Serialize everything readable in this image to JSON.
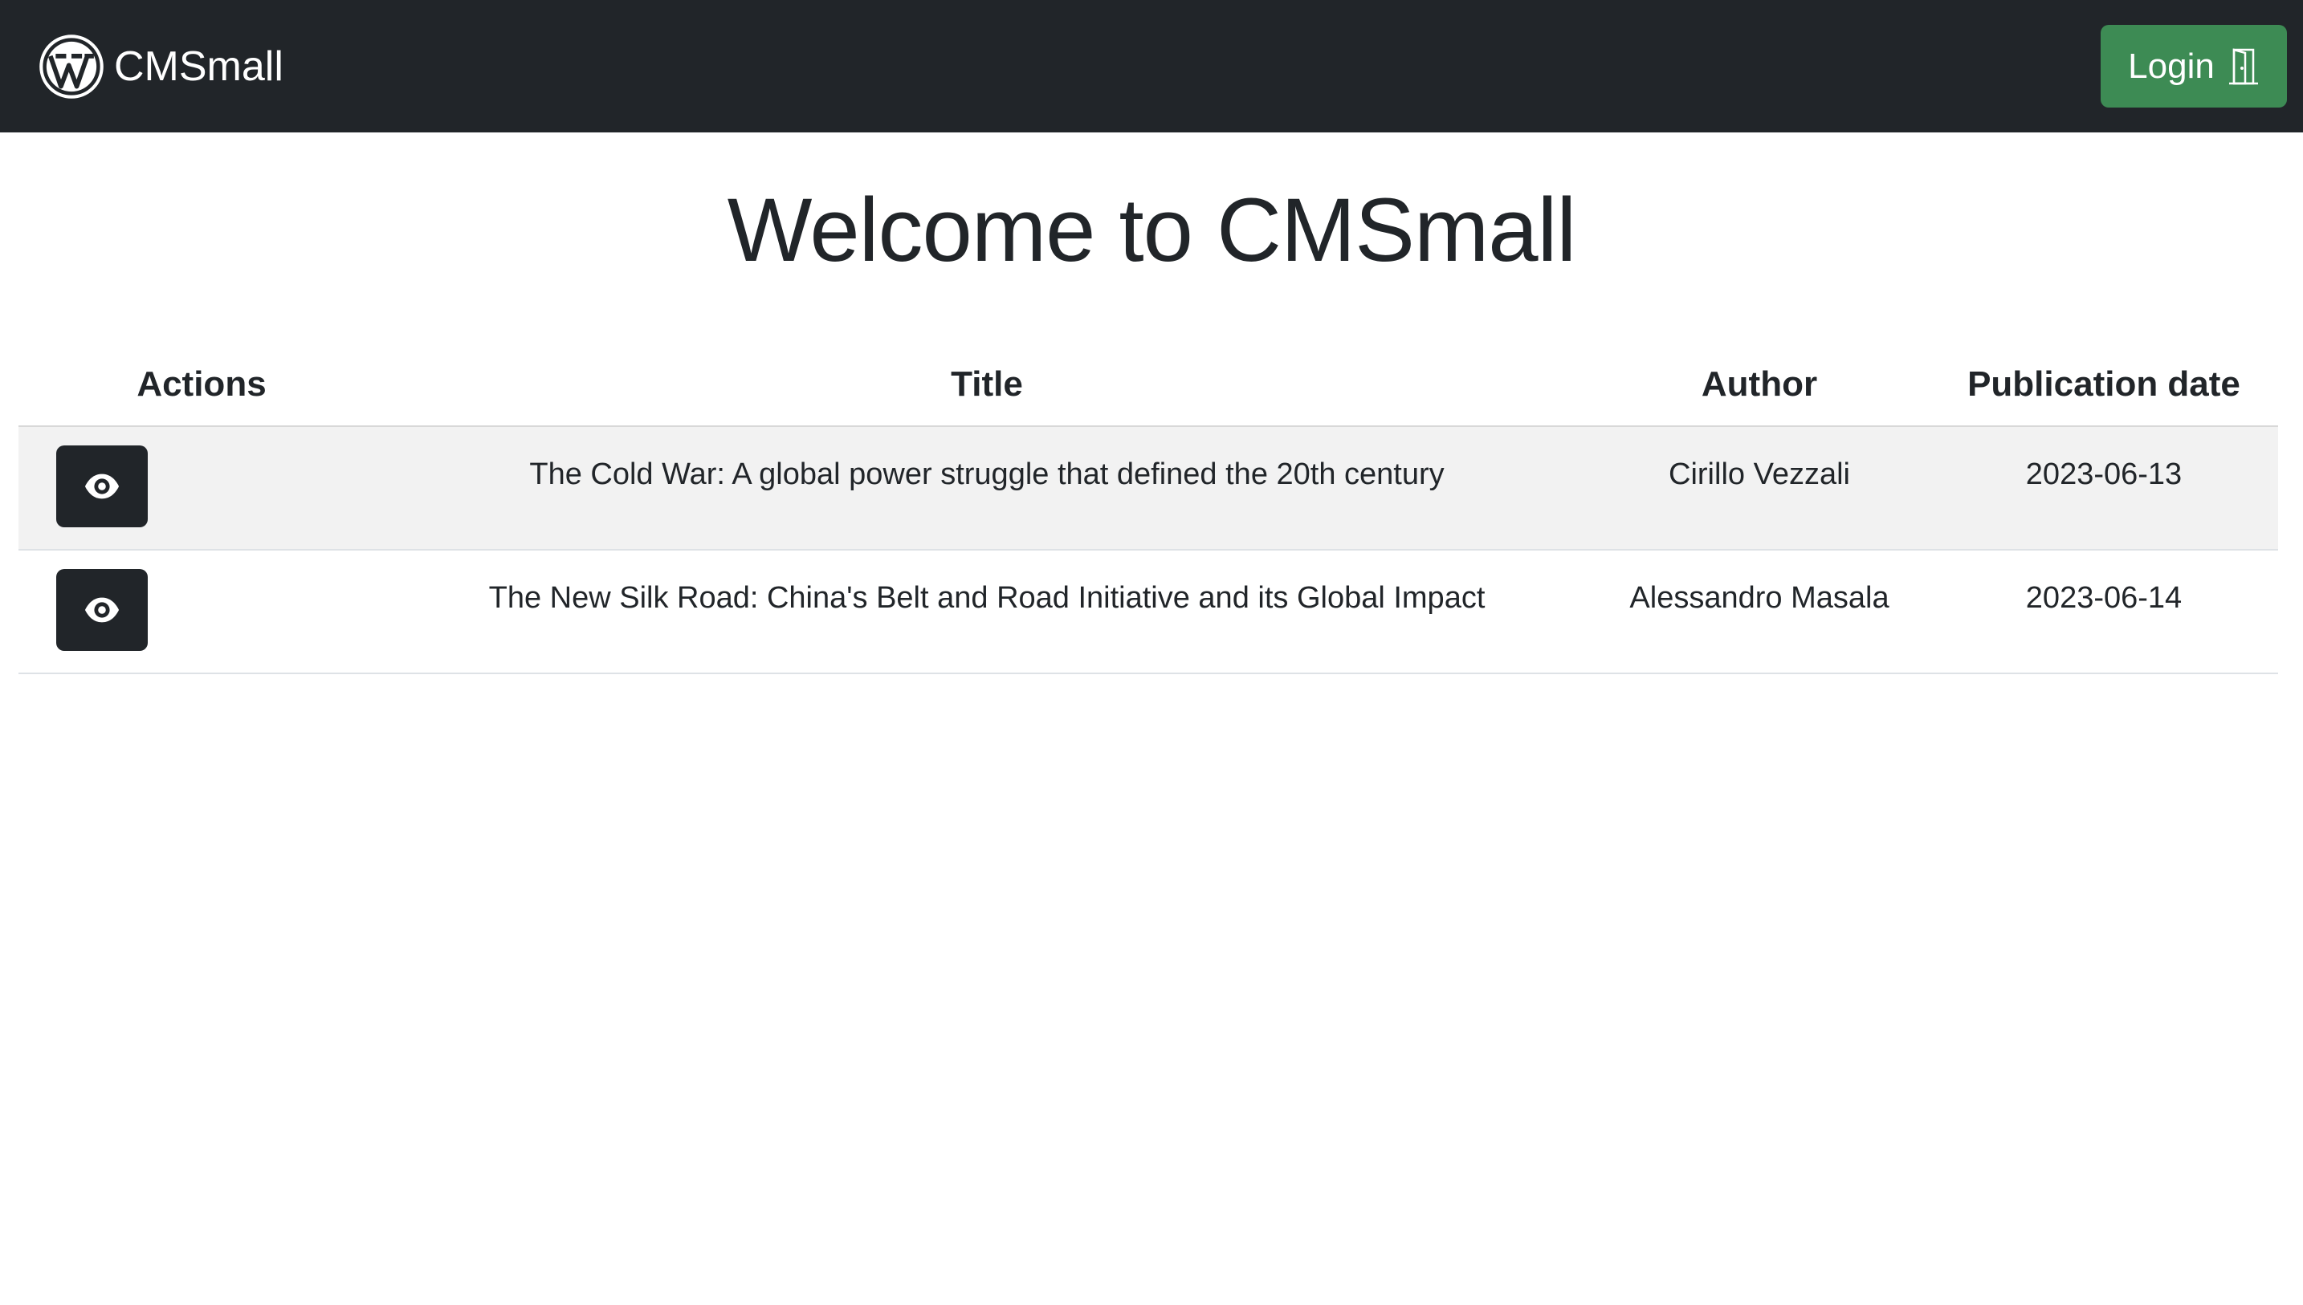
{
  "navbar": {
    "brand_icon": "wordpress-logo-icon",
    "brand_name": "CMSmall",
    "login_label": "Login",
    "login_icon": "door-icon",
    "colors": {
      "background": "#212529",
      "login_button": "#3d8b54"
    }
  },
  "main": {
    "title": "Welcome to CMSmall"
  },
  "table": {
    "headers": [
      "Actions",
      "Title",
      "Author",
      "Publication date"
    ],
    "rows": [
      {
        "action_icon": "eye-icon",
        "title": "The Cold War: A global power struggle that defined the 20th century",
        "author": "Cirillo Vezzali",
        "date": "2023-06-13"
      },
      {
        "action_icon": "eye-icon",
        "title": "The New Silk Road: China's Belt and Road Initiative and its Global Impact",
        "author": "Alessandro Masala",
        "date": "2023-06-14"
      }
    ]
  }
}
